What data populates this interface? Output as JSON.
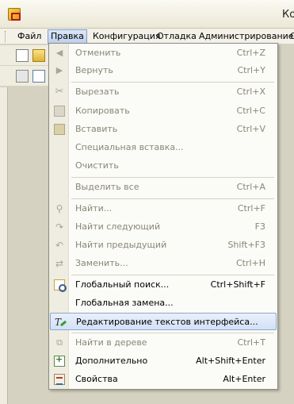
{
  "window": {
    "title": "Ко"
  },
  "menubar": {
    "items": [
      "Файл",
      "Правка",
      "Конфигурация",
      "Отладка",
      "Администрирование",
      "С"
    ]
  },
  "edit_menu": {
    "items": [
      {
        "label": "Отменить",
        "shortcut": "Ctrl+Z",
        "icon": "undo-icon",
        "enabled": false
      },
      {
        "label": "Вернуть",
        "shortcut": "Ctrl+Y",
        "icon": "redo-icon",
        "enabled": false
      },
      {
        "label": "Вырезать",
        "shortcut": "Ctrl+X",
        "icon": "scissors-icon",
        "enabled": false
      },
      {
        "label": "Копировать",
        "shortcut": "Ctrl+C",
        "icon": "copy-icon",
        "enabled": false
      },
      {
        "label": "Вставить",
        "shortcut": "Ctrl+V",
        "icon": "paste-icon",
        "enabled": false
      },
      {
        "label": "Специальная вставка...",
        "shortcut": "",
        "icon": "",
        "enabled": false
      },
      {
        "label": "Очистить",
        "shortcut": "",
        "icon": "",
        "enabled": false
      },
      {
        "label": "Выделить все",
        "shortcut": "Ctrl+A",
        "icon": "",
        "enabled": false
      },
      {
        "label": "Найти...",
        "shortcut": "Ctrl+F",
        "icon": "search-icon",
        "enabled": false
      },
      {
        "label": "Найти следующий",
        "shortcut": "F3",
        "icon": "find-next-icon",
        "enabled": false
      },
      {
        "label": "Найти предыдущий",
        "shortcut": "Shift+F3",
        "icon": "find-previous-icon",
        "enabled": false
      },
      {
        "label": "Заменить...",
        "shortcut": "Ctrl+H",
        "icon": "replace-icon",
        "enabled": false
      },
      {
        "label": "Глобальный поиск...",
        "shortcut": "Ctrl+Shift+F",
        "icon": "global-search-icon",
        "enabled": true
      },
      {
        "label": "Глобальная замена...",
        "shortcut": "",
        "icon": "",
        "enabled": true
      },
      {
        "label": "Редактирование текстов интерфейса...",
        "shortcut": "",
        "icon": "edit-interface-texts-icon",
        "enabled": true,
        "highlighted": true
      },
      {
        "label": "Найти в дереве",
        "shortcut": "Ctrl+T",
        "icon": "find-in-tree-icon",
        "enabled": false
      },
      {
        "label": "Дополнительно",
        "shortcut": "Alt+Shift+Enter",
        "icon": "additional-icon",
        "enabled": true
      },
      {
        "label": "Свойства",
        "shortcut": "Alt+Enter",
        "icon": "properties-icon",
        "enabled": true
      }
    ]
  }
}
